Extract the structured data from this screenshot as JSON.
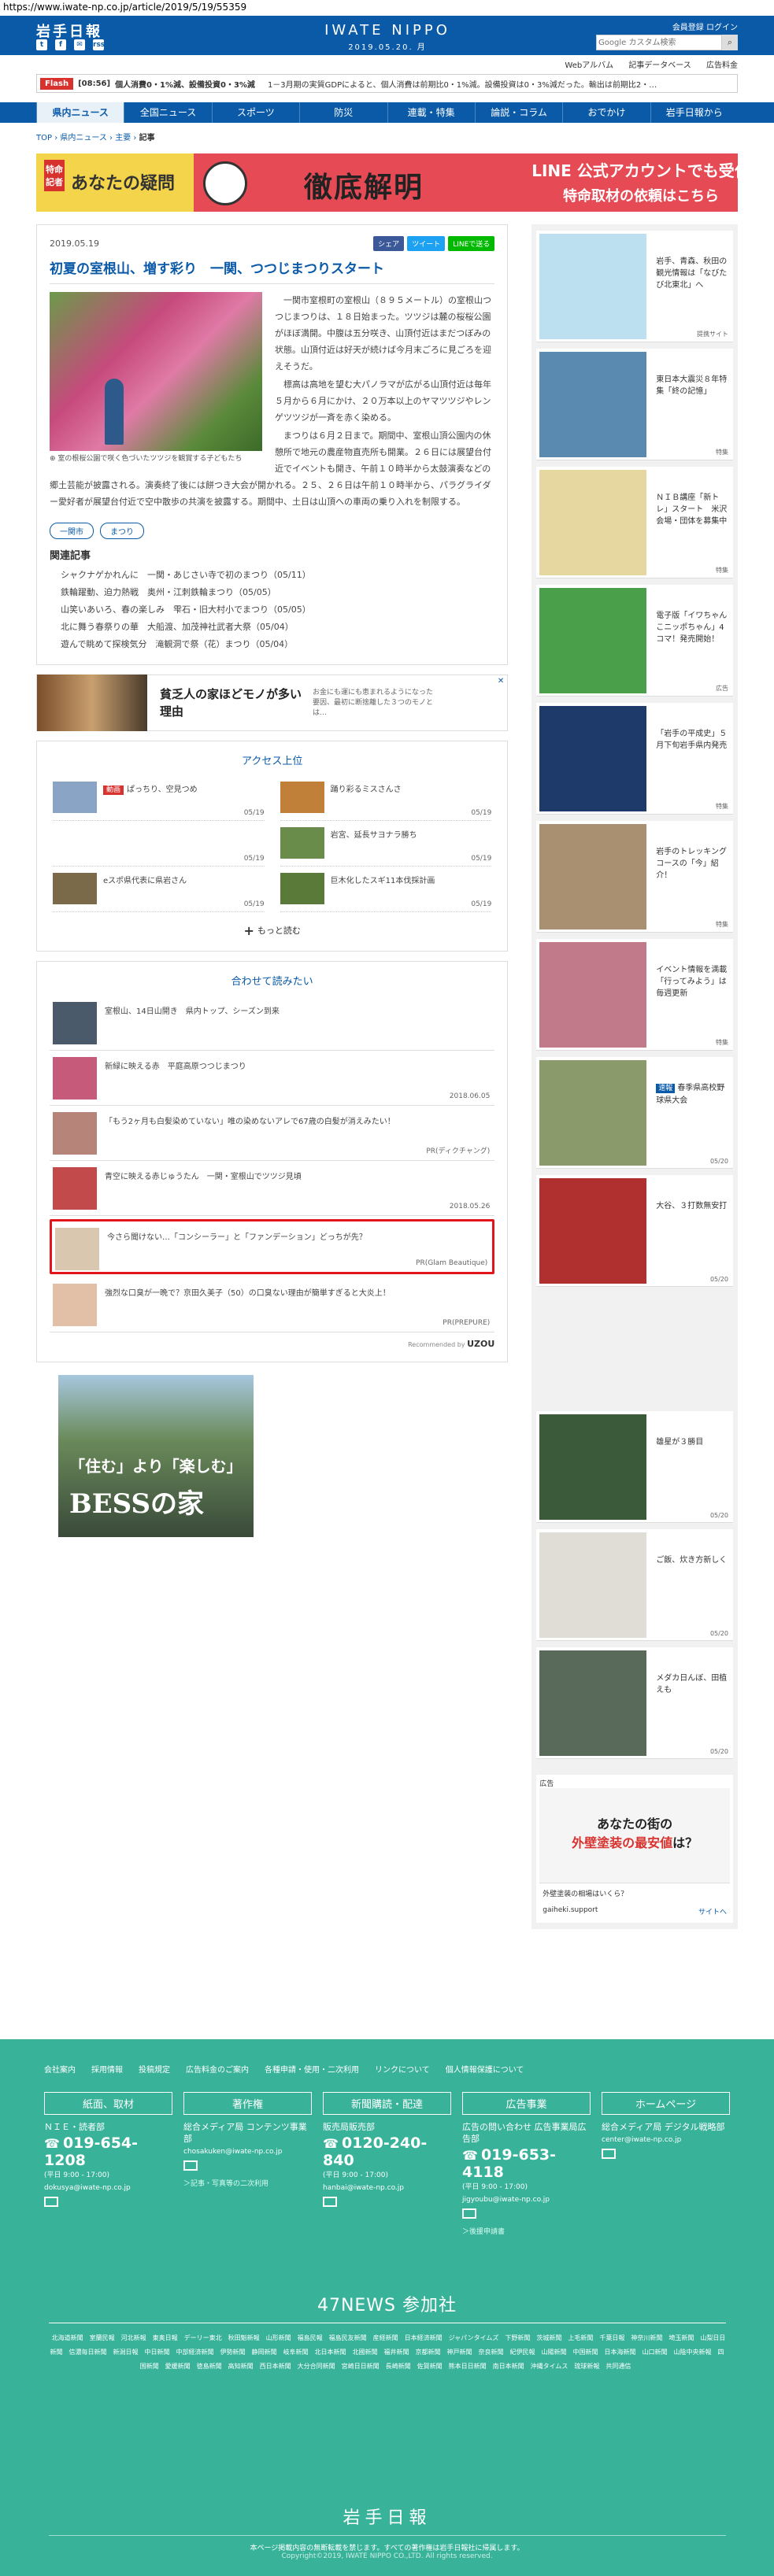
{
  "url": "https://www.iwate-np.co.jp/article/2019/5/19/55359",
  "header": {
    "logo": "岩手日報",
    "masthead": "IWATE NIPPO",
    "date": "2019.05.20. 月",
    "login": "会員登録 ログイン",
    "search_placeholder": "Google カスタム検索",
    "social": [
      "t",
      "f",
      "✉",
      "rss"
    ]
  },
  "subnav": [
    "Webアルバム",
    "記事データベース",
    "広告料金"
  ],
  "flash": {
    "tag": "Flash",
    "time": "[08:56]",
    "items": [
      "個人消費0・1%減、設備投資0・3%減",
      "1－3月期の実質GDPによると、個人消費は前期比0・1%減。設備投資は0・3%減だった。輸出は前期比2・…"
    ]
  },
  "mainnav": [
    "県内ニュース",
    "全国ニュース",
    "スポーツ",
    "防災",
    "連載・特集",
    "論説・コラム",
    "おでかけ",
    "岩手日報から"
  ],
  "crumbs": [
    "TOP",
    "県内ニュース",
    "主要",
    "記事"
  ],
  "banner": {
    "tag": "特命記者",
    "title_left": "あなたの疑問",
    "title": "徹底解明",
    "line1": "LINE 公式アカウントでも受付",
    "line2": "特命取材の依頼はこちら"
  },
  "article": {
    "date": "2019.05.19",
    "share": [
      "シェア",
      "ツイート",
      "LINEで送る"
    ],
    "title": "初夏の室根山、増す彩り　一関、つつじまつりスタート",
    "caption": "室の根桜公園で咲く色づいたツツジを観賞する子どもたち",
    "paragraphs": [
      "一関市室根町の室根山（８９５メートル）の室根山つつじまつりは、１８日始まった。ツツジは麓の桜桜公園がほぼ満開。中腹は五分咲き、山頂付近はまだつぼみの状態。山頂付近は好天が続けば今月末ごろに見ごろを迎えそうだ。",
      "標高は高地を望む大パノラマが広がる山頂付近は毎年５月から６月にかけ、２０万本以上のヤマツツジやレンゲツツジが一斉を赤く染める。",
      "まつりは６月２日まで。期間中、室根山頂公園内の休憩所で地元の農産物直売所も開業。２６日には展望台付近でイベントも開き、午前１０時半から太鼓演奏などの郷土芸能が披露される。演奏終了後には餅つき大会が開かれる。２５、２６日は午前１０時半から、パラグライダー愛好者が展望台付近で空中散歩の共演を披露する。期間中、土日は山頂への車両の乗り入れを制限する。"
    ],
    "tags": [
      "一関市",
      "まつり"
    ],
    "related_title": "関連記事",
    "related": [
      "シャクナゲかれんに　一関・あじさい寺で初のまつり（05/11）",
      "鉄輪躍動、迫力熱戦　奥州・江刺鉄輪まつり（05/05）",
      "山笑いあいろ、春の楽しみ　雫石・旧大村小でまつり（05/05）",
      "北に舞う春祭りの華　大船渡、加茂神社武者大祭（05/04）",
      "遊んで眺めて探検気分　滝観洞で祭（花）まつり（05/04）"
    ]
  },
  "ad_strip": {
    "text": "貧乏人の家ほどモノが多い理由",
    "small": "お金にも運にも恵まれるようになった要因、最初に断捨離した３つのモノとは…",
    "close": "✕"
  },
  "access": {
    "title": "アクセス上位",
    "items": [
      {
        "text": "ぱっちり、空見つめ",
        "badge": "動画",
        "date": "05/19"
      },
      {
        "text": "踊り彩るミスさんさ",
        "badge": "",
        "date": "05/19"
      },
      {
        "text": "",
        "badge": "",
        "date": "05/19"
      },
      {
        "text": "岩宮、延長サヨナラ勝ち",
        "badge": "",
        "date": "05/19"
      },
      {
        "text": "eスポ県代表に県岩さん",
        "badge": "",
        "date": "05/19"
      },
      {
        "text": "巨木化したスギ11本伐採計画",
        "badge": "",
        "date": "05/19"
      }
    ],
    "more": "もっと読む"
  },
  "recs": {
    "title": "合わせて読みたい",
    "items": [
      {
        "text": "室根山、14日山開き　県内トップ、シーズン到来",
        "meta": ""
      },
      {
        "text": "新緑に映える赤　平庭高原つつじまつり",
        "meta": "2018.06.05"
      },
      {
        "text": "「もう2ヶ月も白髪染めていない」唯の染めないアレで67歳の白髪が消えみたい！",
        "meta": "PR(ディクチャング)"
      },
      {
        "text": "青空に映える赤じゅうたん　一関・室根山でツツジ見頃",
        "meta": "2018.05.26"
      },
      {
        "text": "今さら聞けない…「コンシーラー」と「ファンデーション」どっちが先？",
        "meta": "PR(Glam Beautique)"
      },
      {
        "text": "強烈な口臭が一晩で？京田久美子（50）の口臭ない理由が簡単すぎると大炎上！",
        "meta": "PR(PREPURE)"
      }
    ],
    "powered_label": "Recommended by",
    "powered_brand": "UZOU"
  },
  "ad_big": {
    "line1": "「住む」より「楽しむ」",
    "line2": "BESSの家"
  },
  "rightcol": [
    {
      "text": "岩手、青森、秋田の観光情報は「なびたび北東北」へ",
      "badge": "",
      "label": "提携サイト"
    },
    {
      "text": "東日本大震災８年特集「終の記憶」",
      "badge": "",
      "label": "特集"
    },
    {
      "text": "ＮＩＢ講座「新トレ」スタート　米沢会場・団体を募集中",
      "badge": "",
      "label": "特集"
    },
    {
      "text": "電子版「イワちゃんこニッポちゃん」4コマ！発売開始！",
      "badge": "",
      "label": "広告"
    },
    {
      "text": "「岩手の平成史」５月下旬岩手県内発売",
      "badge": "",
      "label": "特集"
    },
    {
      "text": "岩手のトレッキングコースの「今」紹介！",
      "badge": "",
      "label": "特集"
    },
    {
      "text": "イベント情報を満載「行ってみよう」は毎週更新",
      "badge": "",
      "label": "特集"
    },
    {
      "text": "春季県高校野球県大会",
      "badge": "速報",
      "label": "05/20"
    },
    {
      "text": "大谷、３打数無安打",
      "badge": "",
      "label": "05/20"
    },
    {
      "text": "",
      "badge": "",
      "label": ""
    },
    {
      "text": "雄星が３勝目",
      "badge": "",
      "label": "05/20"
    },
    {
      "text": "ご飯、炊き方新しく",
      "badge": "",
      "label": "05/20"
    },
    {
      "text": "メダカ日んぼ、田植えも",
      "badge": "",
      "label": "05/20"
    }
  ],
  "right_ad": {
    "label": "広告",
    "main1": "あなたの街の",
    "main2": "外壁塗装の最安値",
    "main3": "は？",
    "question": "外壁塗装の相場はいくら？",
    "site": "gaiheki.support",
    "go": "サイトへ"
  },
  "footer": {
    "links": [
      "会社案内",
      "採用情報",
      "投稿規定",
      "広告料金のご案内",
      "各種申請・使用・二次利用",
      "リンクについて",
      "個人情報保護について"
    ],
    "cols": [
      {
        "head": "紙面、取材",
        "l1": "ＮＩＥ・読者部",
        "tel": "019-654-1208",
        "l2": "(平日 9:00 - 17:00)",
        "mail": "dokusya@iwate-np.co.jp",
        "link": ""
      },
      {
        "head": "著作権",
        "l1": "総合メディア局 コンテンツ事業部",
        "tel": "",
        "l2": "",
        "mail": "chosakuken@iwate-np.co.jp",
        "link": "＞記事・写真等の二次利用"
      },
      {
        "head": "新聞購読・配達",
        "l1": "販売局販売部",
        "tel": "0120-240-840",
        "l2": "(平日 9:00 - 17:00)",
        "mail": "hanbai@iwate-np.co.jp",
        "link": ""
      },
      {
        "head": "広告事業",
        "l1": "広告の問い合わせ 広告事業局広告部",
        "tel": "019-653-4118",
        "l2": "(平日 9:00 - 17:00)",
        "mail": "jigyoubu@iwate-np.co.jp",
        "link": "＞後援申請書"
      },
      {
        "head": "ホームページ",
        "l1": "総合メディア局 デジタル戦略部",
        "tel": "",
        "l2": "",
        "mail": "center@iwate-np.co.jp",
        "link": ""
      }
    ],
    "news47": "47NEWS 参加社",
    "papers": [
      "北海道新聞",
      "室蘭民報",
      "河北新報",
      "東奥日報",
      "デーリー東北",
      "秋田魁新報",
      "山形新聞",
      "福島民報",
      "福島民友新聞",
      "産経新聞",
      "日本経済新聞",
      "ジャパンタイムズ",
      "下野新聞",
      "茨城新聞",
      "上毛新聞",
      "千葉日報",
      "神奈川新聞",
      "埼玉新聞",
      "山梨日日新聞",
      "信濃毎日新聞",
      "新潟日報",
      "中日新聞",
      "中部経済新聞",
      "伊勢新聞",
      "静岡新聞",
      "岐阜新聞",
      "北日本新聞",
      "北國新聞",
      "福井新聞",
      "京都新聞",
      "神戸新聞",
      "奈良新聞",
      "紀伊民報",
      "山陽新聞",
      "中国新聞",
      "日本海新聞",
      "山口新聞",
      "山陰中央新報",
      "四国新聞",
      "愛媛新聞",
      "徳島新聞",
      "高知新聞",
      "西日本新聞",
      "大分合同新聞",
      "宮崎日日新聞",
      "長崎新聞",
      "佐賀新聞",
      "熊本日日新聞",
      "南日本新聞",
      "沖縄タイムス",
      "琉球新報",
      "共同通信"
    ],
    "logo": "岩手日報",
    "note": "本ページ掲載内容の無断転載を禁じます。すべての著作権は岩手日報社に帰属します。",
    "copy": "Copyright©2019, IWATE NIPPO CO.,LTD. All rights reserved."
  }
}
